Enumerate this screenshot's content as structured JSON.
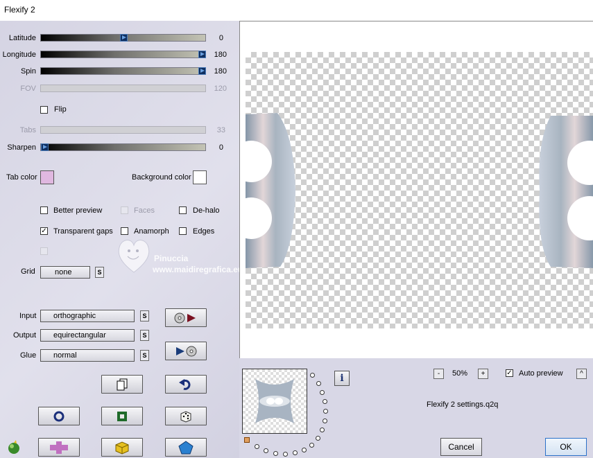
{
  "window": {
    "title": "Flexify 2"
  },
  "sliders": [
    {
      "label": "Latitude",
      "value": "0",
      "fraction": 0.5,
      "enabled": true
    },
    {
      "label": "Longitude",
      "value": "180",
      "fraction": 1.0,
      "enabled": true
    },
    {
      "label": "Spin",
      "value": "180",
      "fraction": 1.0,
      "enabled": true
    },
    {
      "label": "FOV",
      "value": "120",
      "enabled": false
    },
    {
      "label": "Tabs",
      "value": "33",
      "enabled": false
    },
    {
      "label": "Sharpen",
      "value": "0",
      "fraction": 0.0,
      "enabled": true
    }
  ],
  "flip": {
    "label": "Flip",
    "checked": false
  },
  "colors": {
    "tab_label": "Tab color",
    "tab_color": "#e0b8e0",
    "bg_label": "Background color",
    "bg_color": "#ffffff"
  },
  "options": {
    "better_preview": "Better preview",
    "faces": "Faces",
    "de_halo": "De-halo",
    "transparent_gaps": "Transparent gaps",
    "anamorph": "Anamorph",
    "edges": "Edges"
  },
  "grid": {
    "label": "Grid",
    "value": "none",
    "s": "S"
  },
  "projections": {
    "input_label": "Input",
    "input_value": "orthographic",
    "output_label": "Output",
    "output_value": "equirectangular",
    "glue_label": "Glue",
    "glue_value": "normal",
    "s": "S"
  },
  "watermark": {
    "name": "Pinuccia",
    "site": "www.maidiregrafica.eu"
  },
  "zoom": {
    "minus": "-",
    "value": "50%",
    "plus": "+"
  },
  "auto_preview": {
    "label": "Auto preview",
    "checked": true,
    "caret": "^"
  },
  "info": {
    "icon": "i"
  },
  "settings_file": "Flexify 2 settings.q2q",
  "buttons": {
    "cancel": "Cancel",
    "ok": "OK"
  }
}
